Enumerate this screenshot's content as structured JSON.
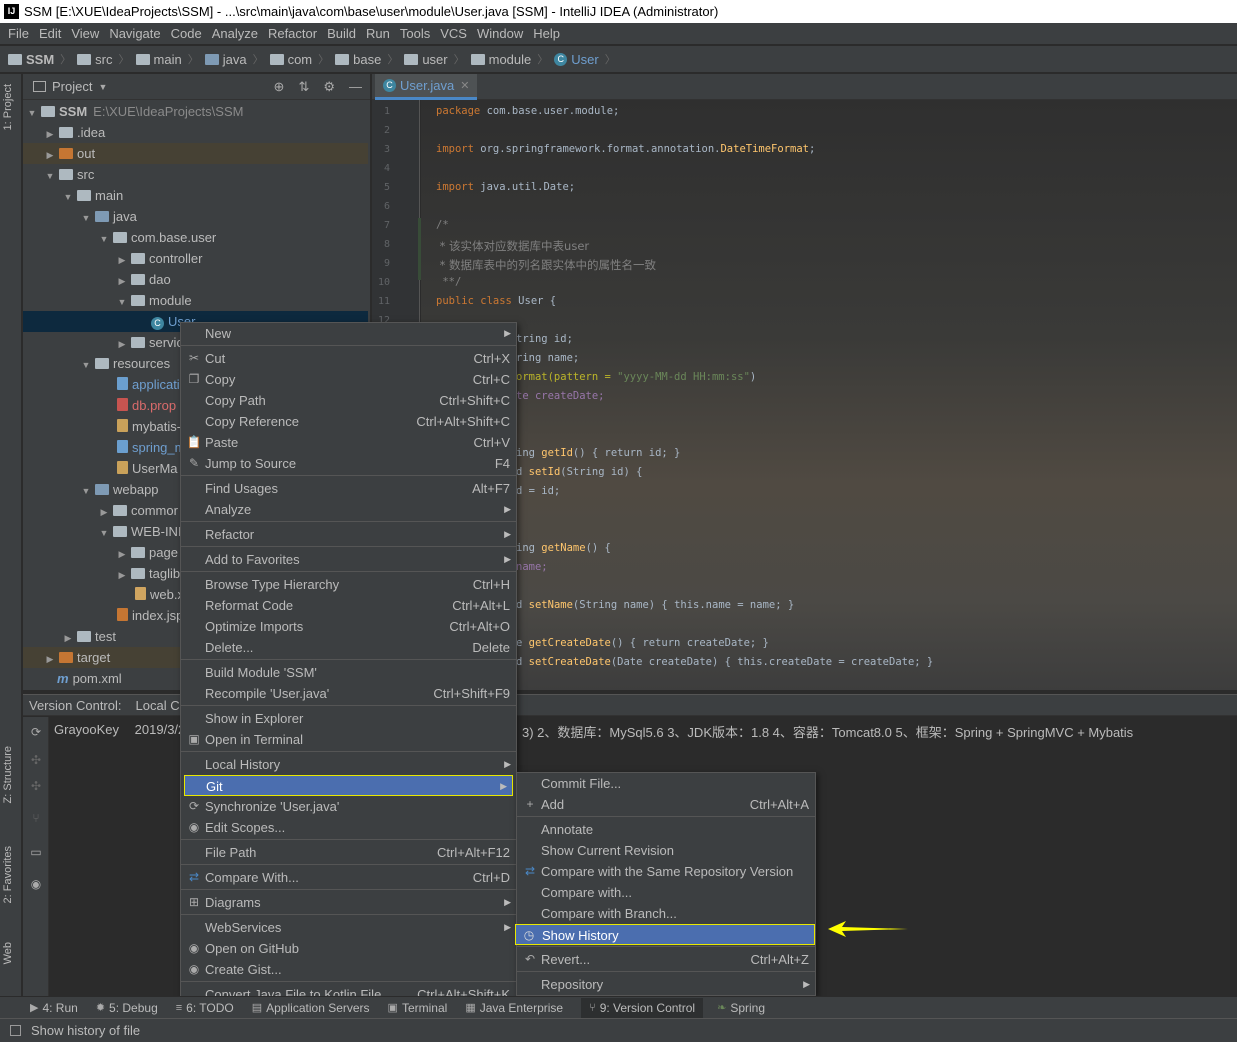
{
  "window": {
    "title": "SSM [E:\\XUE\\IdeaProjects\\SSM] - ...\\src\\main\\java\\com\\base\\user\\module\\User.java [SSM] - IntelliJ IDEA (Administrator)",
    "app_badge": "IJ"
  },
  "menubar": [
    "File",
    "Edit",
    "View",
    "Navigate",
    "Code",
    "Analyze",
    "Refactor",
    "Build",
    "Run",
    "Tools",
    "VCS",
    "Window",
    "Help"
  ],
  "breadcrumb": [
    "SSM",
    "src",
    "main",
    "java",
    "com",
    "base",
    "user",
    "module",
    "User"
  ],
  "left_strip": {
    "project": "1: Project",
    "structure": "Z: Structure",
    "favorites": "2: Favorites",
    "web": "Web"
  },
  "project_panel": {
    "title": "Project"
  },
  "tree": [
    {
      "label": "SSM",
      "extra": "E:\\XUE\\IdeaProjects\\SSM"
    },
    {
      "label": ".idea"
    },
    {
      "label": "out"
    },
    {
      "label": "src"
    },
    {
      "label": "main"
    },
    {
      "label": "java"
    },
    {
      "label": "com.base.user"
    },
    {
      "label": "controller"
    },
    {
      "label": "dao"
    },
    {
      "label": "module"
    },
    {
      "label": "User"
    },
    {
      "label": "servic"
    },
    {
      "label": "resources"
    },
    {
      "label": "applicati"
    },
    {
      "label": "db.prop"
    },
    {
      "label": "mybatis-"
    },
    {
      "label": "spring_m"
    },
    {
      "label": "UserMa"
    },
    {
      "label": "webapp"
    },
    {
      "label": "commor"
    },
    {
      "label": "WEB-INI"
    },
    {
      "label": "page"
    },
    {
      "label": "taglib"
    },
    {
      "label": "web.x"
    },
    {
      "label": "index.jsp"
    },
    {
      "label": "test"
    },
    {
      "label": "target"
    },
    {
      "label": "pom.xml"
    }
  ],
  "editor": {
    "tab": "User.java",
    "line_numbers": [
      "1",
      "2",
      "3",
      "4",
      "5",
      "6",
      "7",
      "8",
      "9",
      "10",
      "11",
      "12"
    ],
    "code": {
      "l1a": "package",
      "l1b": " com.base.user.module;",
      "l3a": "import",
      "l3b": " org.springframework.format.annotation.",
      "l3c": "DateTimeFormat",
      "l3d": ";",
      "l5a": "import",
      "l5b": " java.util.Date;",
      "l7": "/*",
      "l8": " * 该实体对应数据库中表user",
      "l9": " * 数据库表中的列名跟实体中的属性名一致",
      "l10": " **/",
      "l11a": "public class",
      "l11b": " User {",
      "l14": "tring id;",
      "l15": "ring name;",
      "l16a": "ormat(pattern = ",
      "l16b": "\"yyyy-MM-dd HH:mm:ss\"",
      "l16c": ")",
      "l17": "te createDate;",
      "l20a": "ing ",
      "l20b": "getId",
      "l20c": "() { return id; }",
      "l21a": "d ",
      "l21b": "setId",
      "l21c": "(String id) {",
      "l22": "d = id;",
      "l25a": "ing ",
      "l25b": "getName",
      "l25c": "() {",
      "l26": "name;",
      "l28a": "d ",
      "l28b": "setName",
      "l28c": "(String name) { this.name = name; }",
      "l30a": "e ",
      "l30b": "getCreateDate",
      "l30c": "() { return createDate; }",
      "l31a": "d ",
      "l31b": "setCreateDate",
      "l31c": "(Date createDate) { this.createDate = createDate; }"
    }
  },
  "version_control": {
    "label": "Version Control:",
    "tab": "Local C",
    "author": "GrayooKey",
    "date": "2019/3/2",
    "message": "3) 2、数据库：MySql5.6 3、JDK版本：1.8 4、容器：Tomcat8.0 5、框架：Spring + SpringMVC + Mybatis"
  },
  "context_menu": [
    {
      "label": "New",
      "submenu": true
    },
    {
      "label": "Cut",
      "shortcut": "Ctrl+X",
      "icon": "cut-icon"
    },
    {
      "label": "Copy",
      "shortcut": "Ctrl+C",
      "icon": "copy-icon"
    },
    {
      "label": "Copy Path",
      "shortcut": "Ctrl+Shift+C"
    },
    {
      "label": "Copy Reference",
      "shortcut": "Ctrl+Alt+Shift+C"
    },
    {
      "label": "Paste",
      "shortcut": "Ctrl+V",
      "icon": "paste-icon"
    },
    {
      "label": "Jump to Source",
      "shortcut": "F4",
      "icon": "edit-icon"
    },
    {
      "label": "Find Usages",
      "shortcut": "Alt+F7"
    },
    {
      "label": "Analyze",
      "submenu": true
    },
    {
      "label": "Refactor",
      "submenu": true
    },
    {
      "label": "Add to Favorites",
      "submenu": true
    },
    {
      "label": "Browse Type Hierarchy",
      "shortcut": "Ctrl+H"
    },
    {
      "label": "Reformat Code",
      "shortcut": "Ctrl+Alt+L"
    },
    {
      "label": "Optimize Imports",
      "shortcut": "Ctrl+Alt+O"
    },
    {
      "label": "Delete...",
      "shortcut": "Delete"
    },
    {
      "label": "Build Module 'SSM'"
    },
    {
      "label": "Recompile 'User.java'",
      "shortcut": "Ctrl+Shift+F9"
    },
    {
      "label": "Show in Explorer"
    },
    {
      "label": "Open in Terminal",
      "icon": "terminal-icon"
    },
    {
      "label": "Local History",
      "submenu": true
    },
    {
      "label": "Git",
      "submenu": true
    },
    {
      "label": "Synchronize 'User.java'",
      "icon": "sync-icon"
    },
    {
      "label": "Edit Scopes...",
      "icon": "scope-icon"
    },
    {
      "label": "File Path",
      "shortcut": "Ctrl+Alt+F12"
    },
    {
      "label": "Compare With...",
      "shortcut": "Ctrl+D",
      "icon": "compare-icon"
    },
    {
      "label": "Diagrams",
      "submenu": true,
      "icon": "diagram-icon"
    },
    {
      "label": "WebServices",
      "submenu": true
    },
    {
      "label": "Open on GitHub",
      "icon": "github-icon"
    },
    {
      "label": "Create Gist...",
      "icon": "github-icon"
    },
    {
      "label": "Convert Java File to Kotlin File",
      "shortcut": "Ctrl+Alt+Shift+K"
    }
  ],
  "git_submenu": [
    {
      "label": "Commit File..."
    },
    {
      "label": "Add",
      "shortcut": "Ctrl+Alt+A",
      "icon": "plus-icon"
    },
    {
      "label": "Annotate"
    },
    {
      "label": "Show Current Revision"
    },
    {
      "label": "Compare with the Same Repository Version",
      "icon": "compare-icon"
    },
    {
      "label": "Compare with..."
    },
    {
      "label": "Compare with Branch..."
    },
    {
      "label": "Show History",
      "icon": "history-icon"
    },
    {
      "label": "Revert...",
      "shortcut": "Ctrl+Alt+Z",
      "icon": "revert-icon"
    },
    {
      "label": "Repository",
      "submenu": true
    }
  ],
  "bottom_tabs": [
    "4: Run",
    "5: Debug",
    "6: TODO",
    "Application Servers",
    "Terminal",
    "Java Enterprise",
    "9: Version Control",
    "Spring"
  ],
  "status": {
    "text": "Show history of file"
  }
}
